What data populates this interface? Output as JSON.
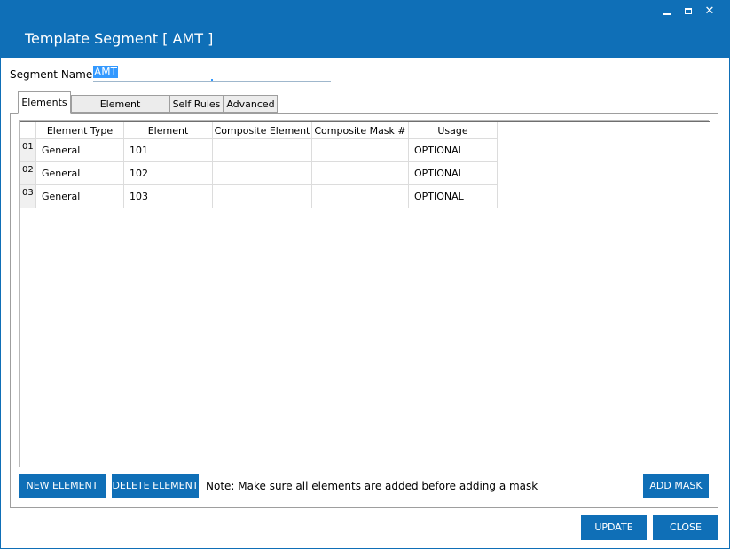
{
  "window": {
    "title": "Template Segment [ AMT ]",
    "controls": [
      "minimize",
      "maximize",
      "close"
    ]
  },
  "segment": {
    "label": "Segment Name",
    "value": "AMT"
  },
  "tabs": [
    {
      "label": "Elements",
      "active": true
    },
    {
      "label": "Element Constraints",
      "active": false
    },
    {
      "label": "Self Rules",
      "active": false
    },
    {
      "label": "Advanced",
      "active": false
    }
  ],
  "grid": {
    "columns": [
      "Element Type",
      "Element",
      "Composite Element",
      "Composite Mask #",
      "Usage"
    ],
    "rows": [
      {
        "num": "01",
        "cells": [
          "General",
          "101",
          "",
          "",
          "OPTIONAL"
        ]
      },
      {
        "num": "02",
        "cells": [
          "General",
          "102",
          "",
          "",
          "OPTIONAL"
        ]
      },
      {
        "num": "03",
        "cells": [
          "General",
          "103",
          "",
          "",
          "OPTIONAL"
        ]
      }
    ]
  },
  "actions": {
    "new_element": "NEW ELEMENT",
    "delete_element": "DELETE ELEMENT",
    "note": "Note: Make sure all elements are added before adding a mask",
    "add_mask": "ADD MASK",
    "update": "UPDATE",
    "close": "CLOSE"
  },
  "colors": {
    "accent": "#0f6fb7",
    "selection": "#3399ff"
  }
}
